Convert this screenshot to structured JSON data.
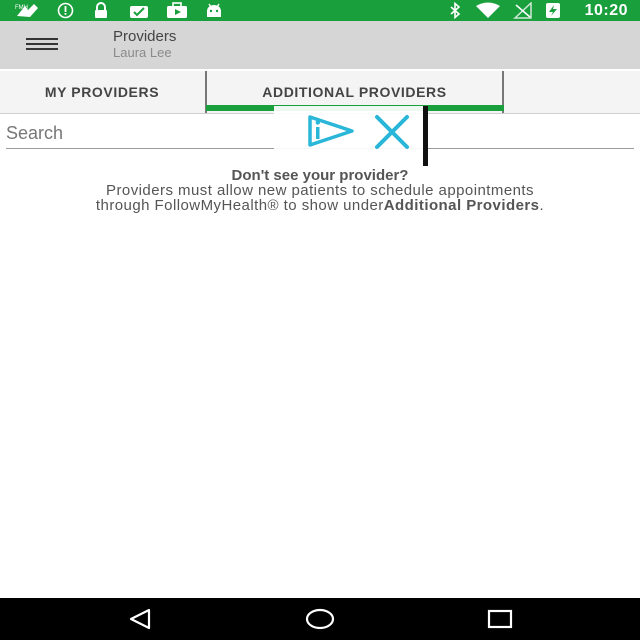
{
  "status_bar": {
    "time": "10:20",
    "icons": [
      "app-notification-icon",
      "info-icon",
      "lock-icon",
      "cloud-check-icon",
      "briefcase-play-icon",
      "android-icon",
      "bluetooth-icon",
      "wifi-icon",
      "no-signal-icon",
      "battery-charging-icon"
    ]
  },
  "header": {
    "title": "Providers",
    "subtitle": "Laura Lee"
  },
  "tabs": [
    {
      "label": "MY PROVIDERS",
      "selected": false
    },
    {
      "label": "ADDITIONAL PROVIDERS",
      "selected": true
    }
  ],
  "search": {
    "placeholder": "Search",
    "value": ""
  },
  "info": {
    "title": "Don't see your provider?",
    "line1": "Providers must allow new patients to schedule appointments",
    "line2_prefix": "through FollowMyHealth® to show under",
    "line2_bold": "Additional Providers",
    "line2_suffix": "."
  },
  "colors": {
    "accent": "#1a9f3d",
    "app_bar": "#d6d6d6",
    "ad_icon": "#29b6d9"
  },
  "nav": {
    "icons": [
      "back-icon",
      "home-icon",
      "recents-icon"
    ]
  }
}
